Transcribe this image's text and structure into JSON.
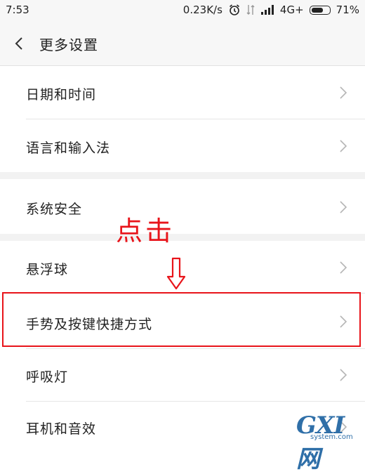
{
  "status_bar": {
    "time": "7:53",
    "speed": "0.23K/s",
    "network": "4G+",
    "battery": "71%",
    "battery_level": 0.71,
    "icons": [
      "alarm-icon",
      "data-transfer-icon",
      "signal-icon",
      "battery-icon"
    ]
  },
  "header": {
    "title": "更多设置",
    "back_icon": "chevron-left-icon"
  },
  "settings": {
    "items": [
      {
        "label": "日期和时间"
      },
      {
        "label": "语言和输入法"
      },
      {
        "label": "系统安全"
      },
      {
        "label": "悬浮球"
      },
      {
        "label": "手势及按键快捷方式"
      },
      {
        "label": "呼吸灯"
      },
      {
        "label": "耳机和音效"
      }
    ]
  },
  "annotation": {
    "text": "点击",
    "arrow_icon": "arrow-down-icon",
    "color": "#e8141a"
  },
  "watermark": {
    "logo_text": "GXI网",
    "domain": "system.com"
  }
}
